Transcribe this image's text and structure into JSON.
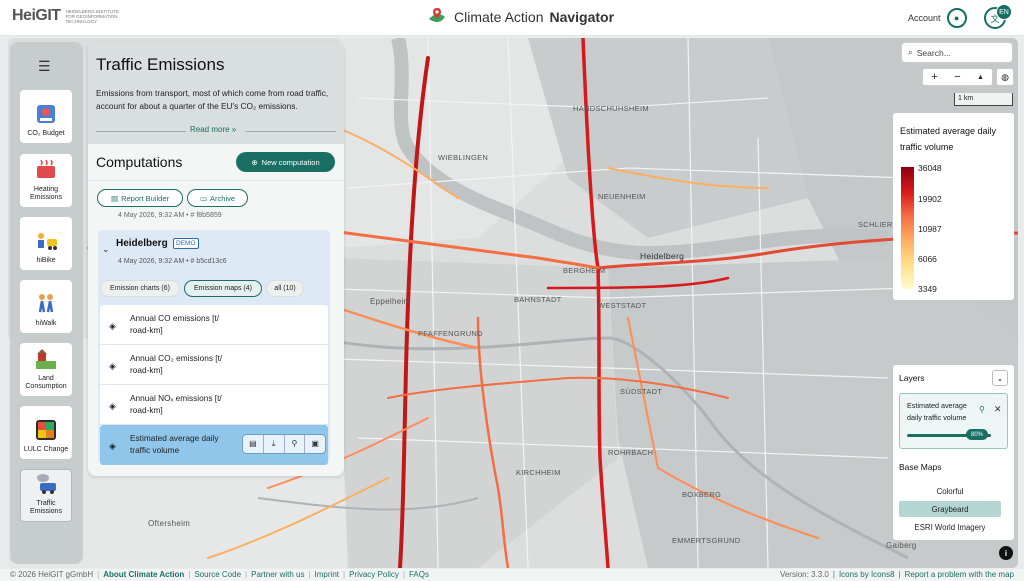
{
  "header": {
    "logo_text": "HeiGIT",
    "logo_subtitle": "Heidelberg Institute for Geoinformation Technology",
    "app_name_light": "Climate Action",
    "app_name_bold": "Navigator",
    "account_label": "Account",
    "language_badge": "EN"
  },
  "nav": {
    "items": [
      {
        "label": "CO₂ Budget",
        "icon": "co2-budget-icon"
      },
      {
        "label": "Heating Emissions",
        "icon": "heating-icon"
      },
      {
        "label": "hiBike",
        "icon": "bike-icon"
      },
      {
        "label": "hiWalk",
        "icon": "walk-icon"
      },
      {
        "label": "Land Consumption",
        "icon": "land-icon"
      },
      {
        "label": "LULC Change",
        "icon": "lulc-icon"
      },
      {
        "label": "Traffic Emissions",
        "icon": "traffic-icon"
      }
    ]
  },
  "panel": {
    "title": "Traffic Emissions",
    "description": "Emissions from transport, most of which come from road traffic, account for about a quarter of the EU's CO₂ emissions.",
    "read_more": "Read more »",
    "computations_title": "Computations",
    "new_computation": "New computation",
    "report_builder": "Report Builder",
    "archive": "Archive",
    "prev_meta": "4 May 2026, 9:32 AM • # f8b5859",
    "card": {
      "title": "Heidelberg",
      "badge": "DEMO",
      "meta": "4 May 2026, 9:32 AM • # b5cd13c6",
      "tabs": [
        "Emission charts (6)",
        "Emission maps (4)",
        "all (10)"
      ],
      "maps": [
        "Annual CO emissions [t/ road-km]",
        "Annual CO₂ emissions [t/ road-km]",
        "Annual NOₓ emissions [t/ road-km]",
        "Estimated average daily traffic volume"
      ]
    }
  },
  "map": {
    "search_placeholder": "Search...",
    "zoom_in": "+",
    "zoom_out": "−",
    "compass": "▲",
    "scale": "1 km",
    "places": [
      {
        "name": "HANDSCHUHSHEIM"
      },
      {
        "name": "WIEBLINGEN"
      },
      {
        "name": "NEUENHEIM"
      },
      {
        "name": "SCHLIERBACH"
      },
      {
        "name": "BERGHEIM"
      },
      {
        "name": "Heidelberg"
      },
      {
        "name": "BAHNSTADT"
      },
      {
        "name": "WESTSTADT"
      },
      {
        "name": "Eppelheim"
      },
      {
        "name": "PFAFFENGRUND"
      },
      {
        "name": "SÜDSTADT"
      },
      {
        "name": "ROHRBACH"
      },
      {
        "name": "KIRCHHEIM"
      },
      {
        "name": "BOXBERG"
      },
      {
        "name": "Oftersheim"
      },
      {
        "name": "EMMERTSGRUND"
      },
      {
        "name": "Gaiberg"
      }
    ]
  },
  "legend": {
    "title": "Estimated average daily traffic volume",
    "ticks": [
      "36048",
      "19902",
      "10987",
      "6066",
      "3349"
    ]
  },
  "layers": {
    "title": "Layers",
    "active_layer": "Estimated average daily traffic volume",
    "opacity_label": "80%",
    "opacity": 0.8,
    "basemaps_title": "Base Maps",
    "basemaps": [
      "Colorful",
      "Graybeard",
      "ESRI World Imagery"
    ],
    "selected_basemap": "Graybeard"
  },
  "footer": {
    "copyright": "© 2026 HeiGIT gGmbH",
    "links": [
      "About Climate Action",
      "Source Code",
      "Partner with us",
      "Imprint",
      "Privacy Policy",
      "FAQs"
    ],
    "version": "Version: 3.3.0",
    "icons_credit": "Icons by Icons8",
    "report_problem": "Report a problem with the map"
  },
  "colors": {
    "accent": "#1a6f65",
    "selected_row": "#8fc6ea",
    "card_bg": "#dde9f5"
  }
}
